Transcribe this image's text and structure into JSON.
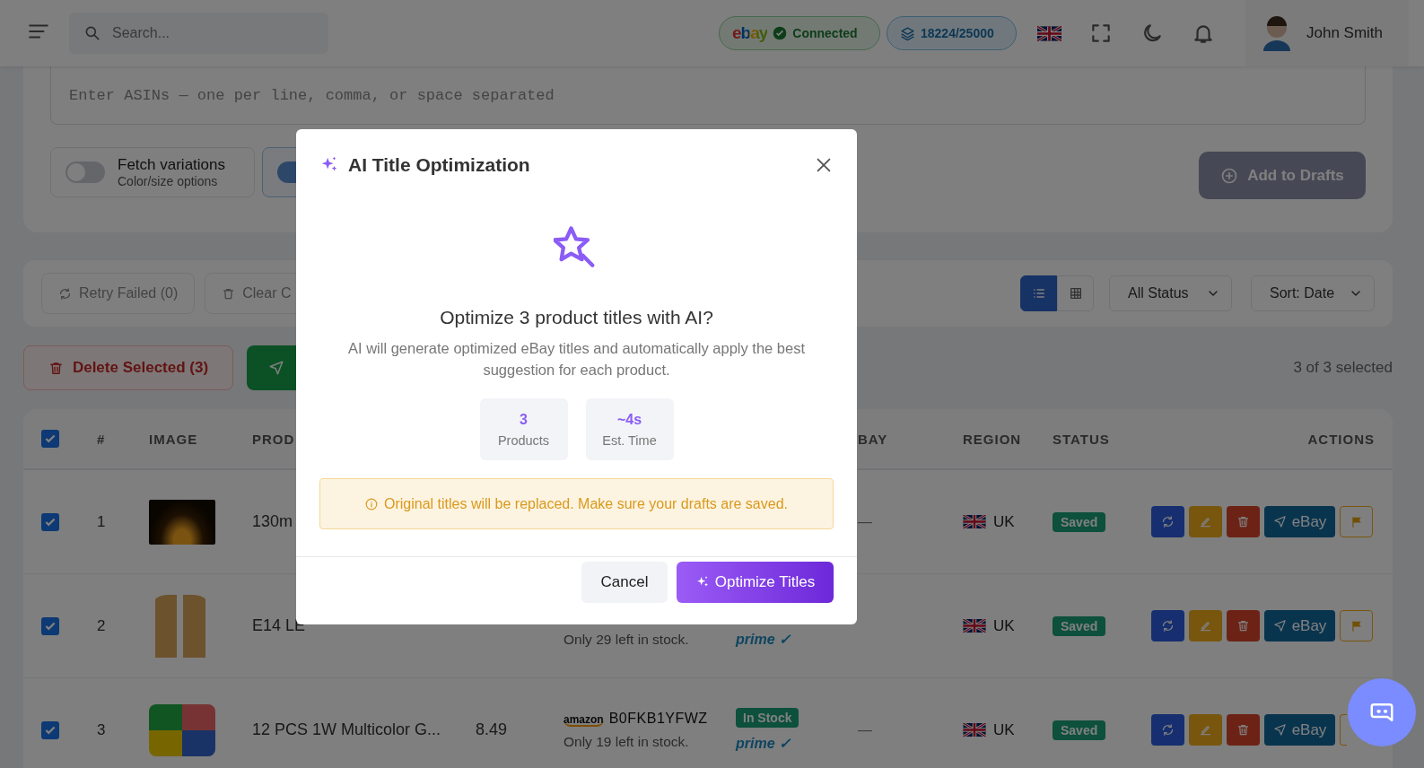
{
  "header": {
    "search": {
      "placeholder": "Search..."
    },
    "marketplace": {
      "logo": "ebay",
      "status": "Connected"
    },
    "credits": "18224/25000",
    "user": {
      "name": "John Smith"
    }
  },
  "import_card": {
    "asin_field": {
      "placeholder": "Enter ASINs — one per line, comma, or space separated"
    },
    "toggles": [
      {
        "title": "Fetch variations",
        "subtitle": "Color/size options",
        "on": false
      },
      {
        "on": true
      }
    ],
    "add_button": "Add to Drafts"
  },
  "toolbar": {
    "buttons": [
      {
        "kind": "retry",
        "label": "Retry Failed (0)"
      },
      {
        "kind": "clear",
        "label": "Clear C"
      }
    ],
    "views": [
      {
        "kind": "list",
        "selected": true
      },
      {
        "kind": "grid",
        "selected": false
      }
    ],
    "filters": [
      {
        "label": "All Status"
      },
      {
        "label": "Sort: Date"
      }
    ]
  },
  "bulk_bar": {
    "delete_button": "Delete Selected (3)",
    "selection_count": "3 of 3 selected"
  },
  "table": {
    "all_selected": true,
    "columns": [
      "#",
      "IMAGE",
      "PROD",
      "",
      "",
      "",
      "BAY",
      "REGION",
      "STATUS",
      "ACTIONS"
    ],
    "rows": [
      {
        "selected": true,
        "number": "1",
        "title": "130m",
        "ebay": "—",
        "region": "UK",
        "status": "Saved",
        "action_label": "eBay"
      },
      {
        "selected": true,
        "number": "2",
        "title": "E14 LE",
        "stock_note": "Only 29 left in stock.",
        "prime": "prime ✓",
        "region": "UK",
        "status": "Saved",
        "action_label": "eBay"
      },
      {
        "selected": true,
        "number": "3",
        "title": "12 PCS 1W Multicolor G...",
        "price": "8.49",
        "source_logo": "amazon",
        "asin": "B0FKB1YFWZ",
        "stock_note": "Only 19 left in stock.",
        "stock_badge": "In Stock",
        "prime": "prime ✓",
        "ebay": "—",
        "region": "UK",
        "status": "Saved",
        "action_label": "eBay"
      }
    ]
  },
  "dialog": {
    "title": "AI Title Optimization",
    "heading": "Optimize 3 product titles with AI?",
    "description": "AI will generate optimized eBay titles and automatically apply the best suggestion for each product.",
    "stats": [
      {
        "value": "3",
        "label": "Products"
      },
      {
        "value": "~4s",
        "label": "Est. Time"
      }
    ],
    "warning": "Original titles will be replaced. Make sure your drafts are saved.",
    "buttons": [
      {
        "kind": "cancel",
        "label": "Cancel"
      },
      {
        "kind": "primary",
        "label": "Optimize Titles"
      }
    ]
  }
}
